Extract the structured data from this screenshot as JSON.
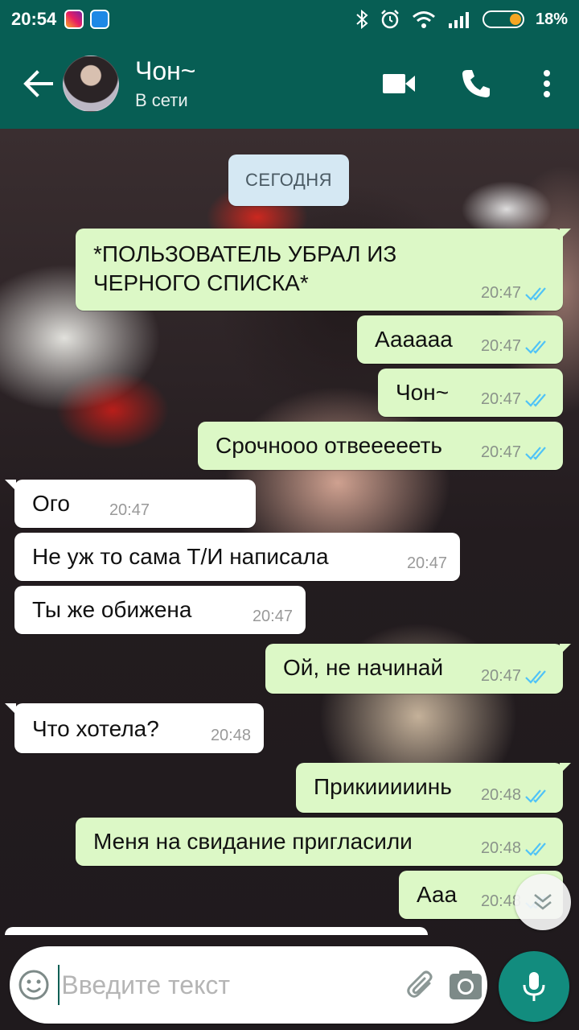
{
  "status_bar": {
    "time": "20:54",
    "battery": "18%",
    "icons": [
      "instagram-icon",
      "files-icon",
      "bluetooth-icon",
      "alarm-icon",
      "wifi-icon",
      "signal-icon",
      "battery-icon"
    ]
  },
  "header": {
    "contact_name": "Чон~",
    "presence": "В сети",
    "icons": [
      "back-arrow-icon",
      "video-call-icon",
      "phone-icon",
      "more-vert-icon"
    ]
  },
  "date_divider": "СЕГОДНЯ",
  "messages": [
    {
      "dir": "out",
      "line1": "*ПОЛЬЗОВАТЕЛЬ УБРАЛ ИЗ",
      "line2": "ЧЕРНОГО СПИСКА*",
      "time": "20:47",
      "read": true
    },
    {
      "dir": "out",
      "text": "Аааааа",
      "time": "20:47",
      "read": true
    },
    {
      "dir": "out",
      "text": "Чон~",
      "time": "20:47",
      "read": true
    },
    {
      "dir": "out",
      "text": "Срочнооо отвеееееть",
      "time": "20:47",
      "read": true
    },
    {
      "dir": "in",
      "text": "Ого",
      "time": "20:47"
    },
    {
      "dir": "in",
      "text": "Не уж то сама Т/И написала",
      "time": "20:47"
    },
    {
      "dir": "in",
      "text": "Ты же обижена",
      "time": "20:47"
    },
    {
      "dir": "out",
      "text": "Ой, не начинай",
      "time": "20:47",
      "read": true
    },
    {
      "dir": "in",
      "text": "Что хотела?",
      "time": "20:48"
    },
    {
      "dir": "out",
      "text": "Прикииииинь",
      "time": "20:48",
      "read": true
    },
    {
      "dir": "out",
      "text": "Меня на свидание пригласили",
      "time": "20:48",
      "read": true
    },
    {
      "dir": "out",
      "text": "Ааа",
      "time": "20:48",
      "read": true
    }
  ],
  "composer": {
    "placeholder": "Введите текст",
    "value": ""
  },
  "colors": {
    "header": "#075e54",
    "outgoing_bubble": "#dcf8c6",
    "incoming_bubble": "#ffffff",
    "read_ticks": "#4fc3f7",
    "fab": "#128c7e"
  }
}
